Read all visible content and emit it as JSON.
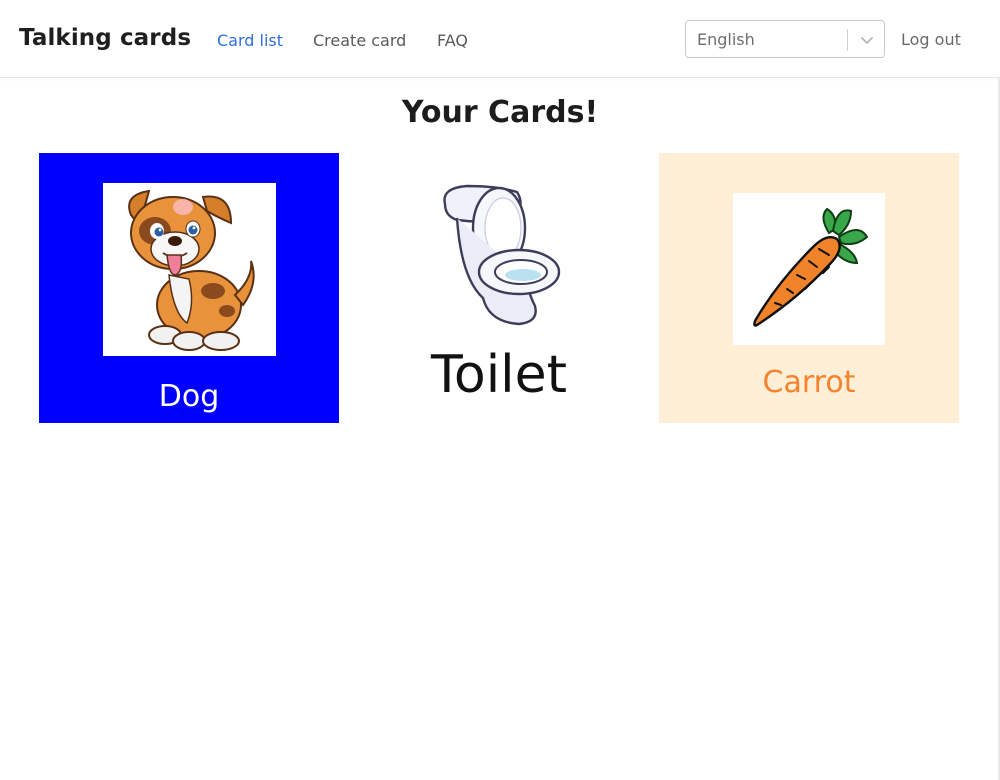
{
  "navbar": {
    "brand": "Talking cards",
    "links": [
      {
        "label": "Card list",
        "active": true
      },
      {
        "label": "Create card",
        "active": false
      },
      {
        "label": "FAQ",
        "active": false
      }
    ],
    "language": {
      "selected": "English"
    },
    "logout_label": "Log out"
  },
  "page": {
    "title": "Your Cards!"
  },
  "cards": [
    {
      "label": "Dog",
      "background": "#0000ff",
      "label_color": "#ffffff",
      "icon": "dog-image"
    },
    {
      "label": "Toilet",
      "background": "#ffffff",
      "label_color": "#111111",
      "icon": "toilet-image"
    },
    {
      "label": "Carrot",
      "background": "#ffefd6",
      "label_color": "#f5822e",
      "icon": "carrot-image"
    }
  ],
  "colors": {
    "active_link": "#2f6fe0",
    "text_dark": "#1f1f1f"
  }
}
